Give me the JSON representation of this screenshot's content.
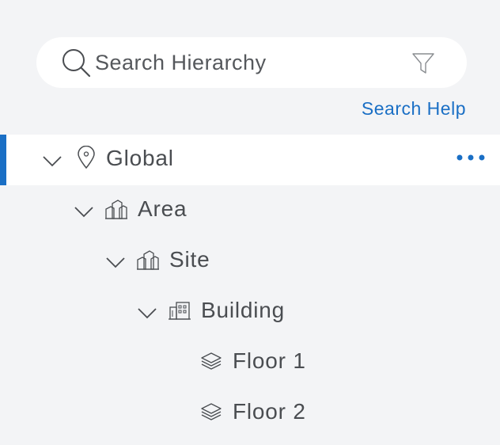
{
  "search": {
    "placeholder": "Search Hierarchy",
    "help_link": "Search Help"
  },
  "tree": {
    "nodes": [
      {
        "label": "Global",
        "icon": "location-pin-icon",
        "expanded": true,
        "selected": true
      },
      {
        "label": "Area",
        "icon": "area-buildings-icon",
        "expanded": true,
        "selected": false
      },
      {
        "label": "Site",
        "icon": "site-buildings-icon",
        "expanded": true,
        "selected": false
      },
      {
        "label": "Building",
        "icon": "building-icon",
        "expanded": true,
        "selected": false
      },
      {
        "label": "Floor 1",
        "icon": "floor-layers-icon",
        "selected": false
      },
      {
        "label": "Floor 2",
        "icon": "floor-layers-icon",
        "selected": false
      }
    ]
  },
  "colors": {
    "accent": "#1a6fc5",
    "background": "#f3f4f6",
    "selected_row": "#ffffff",
    "text": "#4a4d51"
  }
}
